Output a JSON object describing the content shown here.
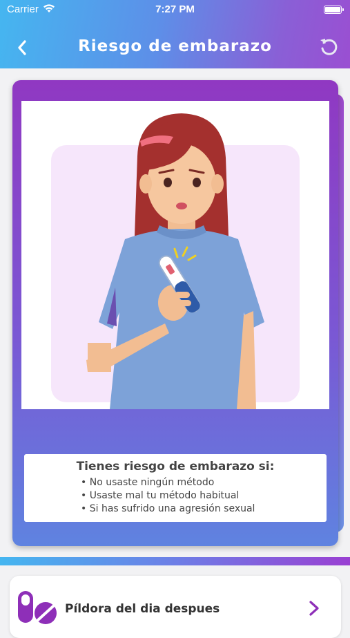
{
  "status_bar": {
    "carrier": "Carrier",
    "time": "7:27 PM"
  },
  "header": {
    "title": "Riesgo de embarazo",
    "back_icon": "chevron-left-icon",
    "reload_icon": "reload-icon"
  },
  "card": {
    "illustration": "worried-woman-holding-pregnancy-test",
    "info_title": "Tienes riesgo de embarazo si:",
    "bullets": [
      "No usaste ningún método",
      "Usaste mal tu método habitual",
      "Si has sufrido una agresión sexual"
    ]
  },
  "options": [
    {
      "label": "Píldora del dia despues",
      "icon": "pill-icon",
      "chevron": "chevron-right-icon"
    }
  ],
  "colors": {
    "header_start": "#45b6f0",
    "header_end": "#9a4fd2",
    "card_top": "#9038c2",
    "card_bottom": "#5f83e0",
    "accent": "#8e2fb8"
  }
}
